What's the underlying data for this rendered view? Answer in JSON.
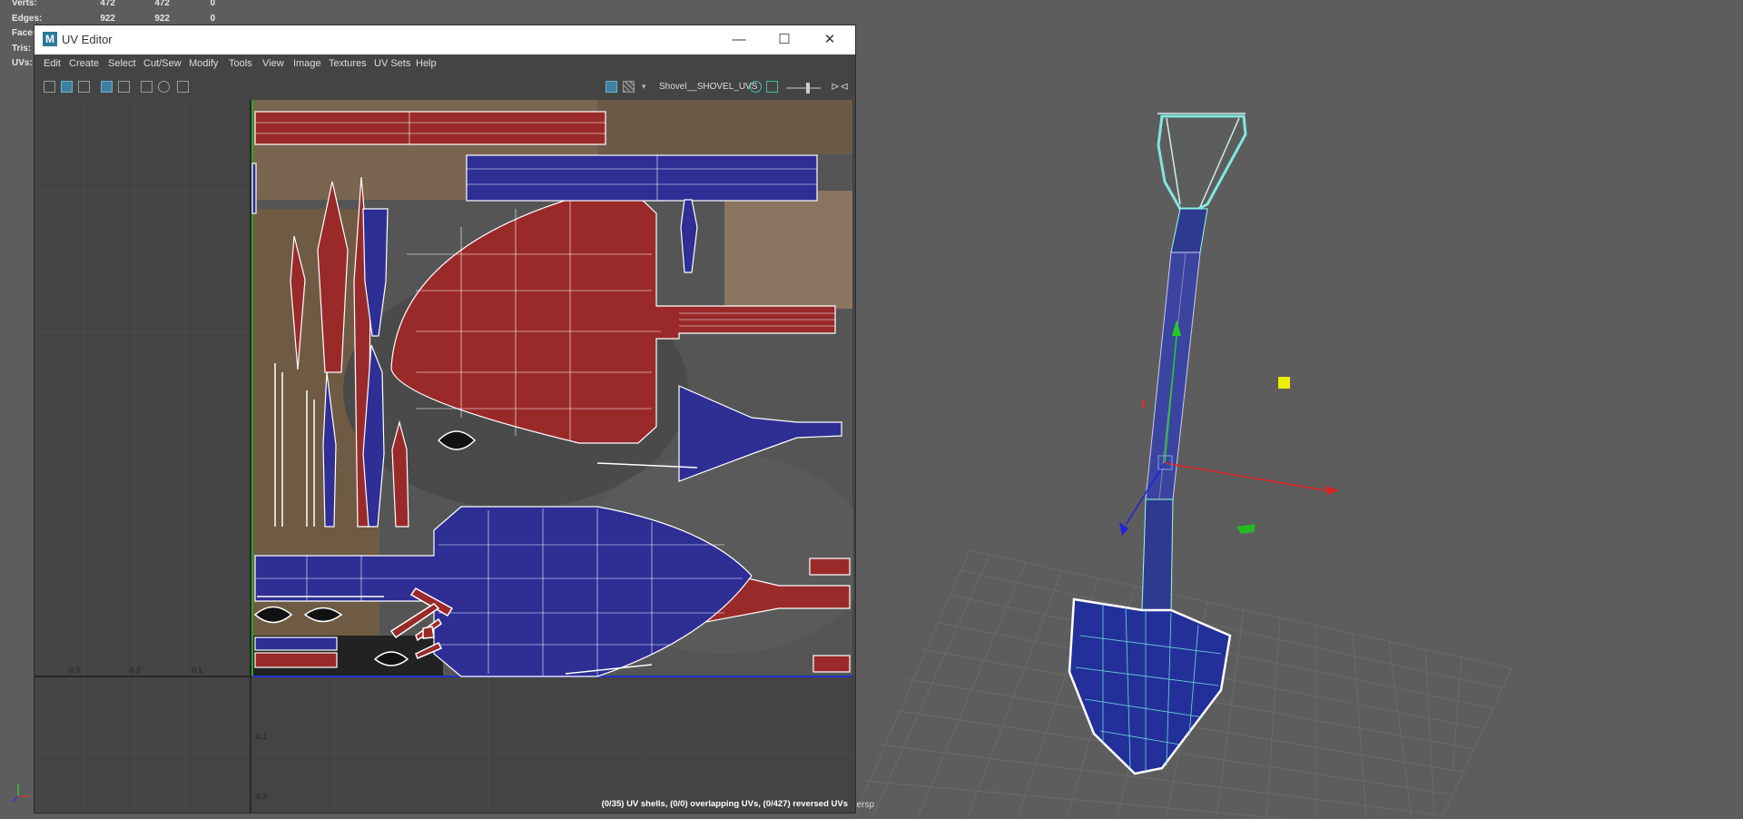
{
  "hud": {
    "rows": [
      {
        "label": "Verts:",
        "v1": "472",
        "v2": "472",
        "v3": "0"
      },
      {
        "label": "Edges:",
        "v1": "922",
        "v2": "922",
        "v3": "0"
      },
      {
        "label": "Faces:",
        "v1": "",
        "v2": "",
        "v3": ""
      },
      {
        "label": "Tris:",
        "v1": "",
        "v2": "",
        "v3": ""
      },
      {
        "label": "UVs:",
        "v1": "",
        "v2": "",
        "v3": ""
      }
    ]
  },
  "viewport": {
    "camera_label": "persp"
  },
  "uv_editor": {
    "title": "UV Editor",
    "app_logo": "M",
    "window_buttons": {
      "minimize": "—",
      "maximize": "☐",
      "close": "✕"
    },
    "menu": [
      "Edit",
      "Create",
      "Select",
      "Cut/Sew",
      "Modify",
      "Tools",
      "View",
      "Image",
      "Textures",
      "UV Sets",
      "Help"
    ],
    "uv_set": "Shovel__SHOVEL_UVS",
    "status": "(0/35) UV shells, (0/0) overlapping UVs, (0/427) reversed UVs",
    "grid_labels": {
      "x": [
        "-0.3",
        "-0.2",
        "-0.1"
      ],
      "y": [
        "-0.1",
        "-0.2"
      ]
    }
  },
  "colors": {
    "red_shell": "#9a2a2a",
    "blue_shell": "#2e2e95",
    "viewport_bg": "#5d5d5d",
    "accent": "#3f7f9f"
  }
}
